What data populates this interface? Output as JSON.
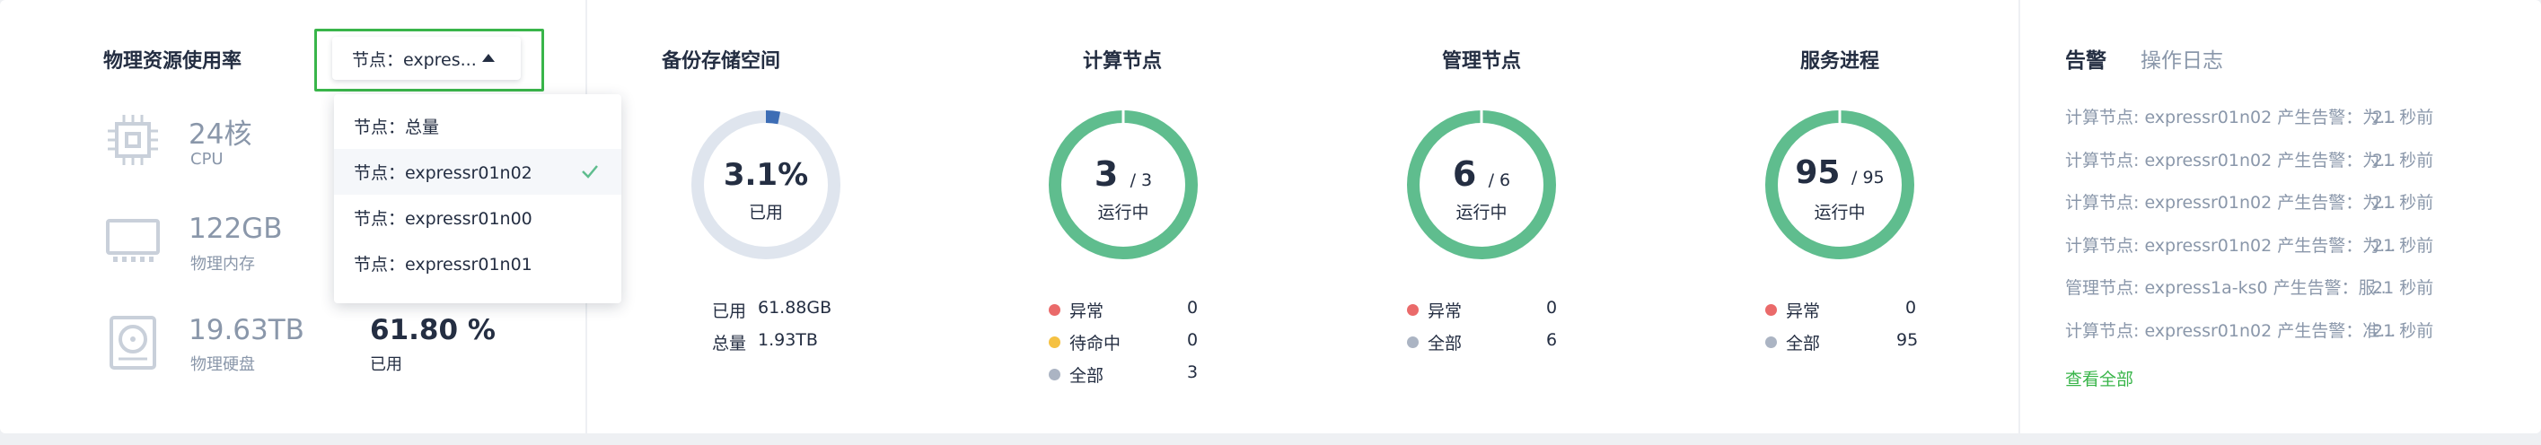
{
  "usage": {
    "title": "物理资源使用率",
    "selector_label": "节点：expres...",
    "cpu": {
      "value": "24核",
      "label": "CPU"
    },
    "memory": {
      "value": "122GB",
      "label": "物理内存"
    },
    "disk": {
      "value": "19.63TB",
      "label": "物理硬盘",
      "percent": "61.80 %",
      "percent_label": "已用"
    }
  },
  "dropdown": {
    "options": [
      "节点：总量",
      "节点：expressr01n02",
      "节点：expressr01n00",
      "节点：expressr01n01"
    ],
    "selected_index": 1
  },
  "backup": {
    "title": "备份存储空间",
    "percent": "3.1%",
    "percent_value": 3.1,
    "status": "已用",
    "used_label": "已用",
    "used_value": "61.88GB",
    "total_label": "总量",
    "total_value": "1.93TB"
  },
  "compute": {
    "title": "计算节点",
    "count": "3",
    "total": "/ 3",
    "status": "运行中",
    "legend": [
      {
        "label": "异常",
        "value": "0",
        "color": "#ea6a6a"
      },
      {
        "label": "待命中",
        "value": "0",
        "color": "#f5c142"
      },
      {
        "label": "全部",
        "value": "3",
        "color": "#abb4c3"
      }
    ]
  },
  "management": {
    "title": "管理节点",
    "count": "6",
    "total": "/ 6",
    "status": "运行中",
    "legend": [
      {
        "label": "异常",
        "value": "0",
        "color": "#ea6a6a"
      },
      {
        "label": "全部",
        "value": "6",
        "color": "#abb4c3"
      }
    ]
  },
  "services": {
    "title": "服务进程",
    "count": "95",
    "total": "/ 95",
    "status": "运行中",
    "legend": [
      {
        "label": "异常",
        "value": "0",
        "color": "#ea6a6a"
      },
      {
        "label": "全部",
        "value": "95",
        "color": "#abb4c3"
      }
    ]
  },
  "alerts": {
    "tab_alerts": "告警",
    "tab_logs": "操作日志",
    "items": [
      {
        "text": "计算节点: expressr01n02 产生告警：为...",
        "time": "21 秒前"
      },
      {
        "text": "计算节点: expressr01n02 产生告警：为...",
        "time": "21 秒前"
      },
      {
        "text": "计算节点: expressr01n02 产生告警：为...",
        "time": "21 秒前"
      },
      {
        "text": "计算节点: expressr01n02 产生告警：为...",
        "time": "21 秒前"
      },
      {
        "text": "管理节点: express1a-ks0 产生告警：服...",
        "time": "21 秒前"
      },
      {
        "text": "计算节点: expressr01n02 产生告警：准...",
        "time": "21 秒前"
      }
    ],
    "view_all": "查看全部"
  },
  "colors": {
    "ring_green": "#5fbd8e",
    "ring_blue": "#3d6db5",
    "ring_track": "#dfe5ee",
    "accent_green": "#39b54a"
  }
}
